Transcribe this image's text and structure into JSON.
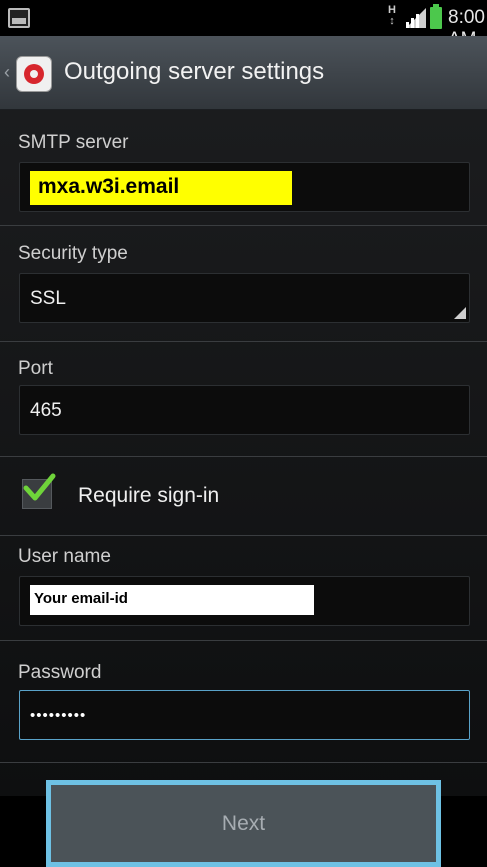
{
  "status_bar": {
    "network_type": "H\n1↕",
    "time": "8:00 AM",
    "icons": [
      "screenshot-notification-icon",
      "network-type-icon",
      "signal-icon",
      "battery-icon"
    ]
  },
  "action_bar": {
    "title": "Outgoing server settings",
    "icons": [
      "back-chevron-icon",
      "email-app-icon"
    ]
  },
  "form": {
    "smtp": {
      "label": "SMTP server",
      "value": "mxa.w3i.email",
      "highlight_color": "#ffff00"
    },
    "security": {
      "label": "Security type",
      "value": "SSL"
    },
    "port": {
      "label": "Port",
      "value": "465"
    },
    "require_signin": {
      "label": "Require sign-in",
      "checked": true,
      "check_color": "#6fd43a"
    },
    "username": {
      "label": "User name",
      "value": "Your email-id"
    },
    "password": {
      "label": "Password",
      "value": "•••••••••"
    }
  },
  "footer": {
    "next_label": "Next",
    "accent": "#6ec1e4"
  }
}
